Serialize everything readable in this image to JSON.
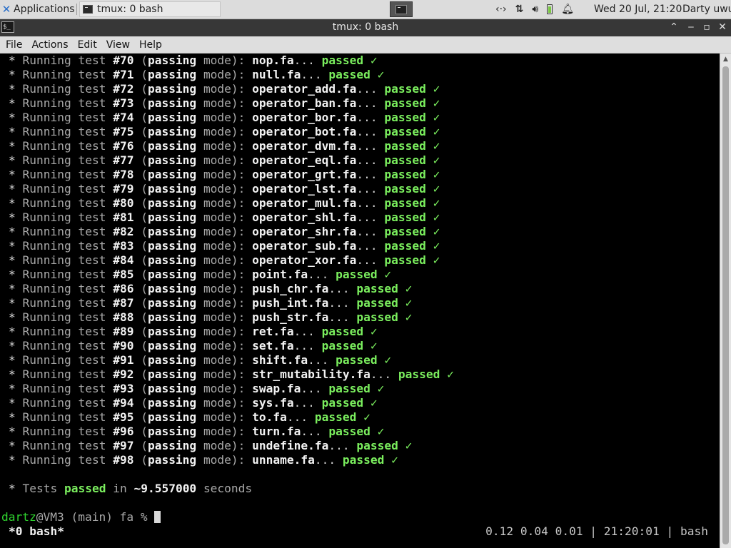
{
  "panel": {
    "apps_label": "Applications",
    "task_label": "tmux: 0 bash",
    "clock": "Wed 20 Jul, 21:20",
    "user": "Darty uwu",
    "icons": [
      "xfce-icon",
      "terminal-icon",
      "network-icon",
      "transfer-icon",
      "volume-icon",
      "battery-icon",
      "notification-bell-icon"
    ]
  },
  "window": {
    "title": "tmux: 0 bash",
    "icon_text": "$_"
  },
  "menubar": {
    "file": "File",
    "actions": "Actions",
    "edit": "Edit",
    "view": "View",
    "help": "Help"
  },
  "tests": [
    {
      "num": "#70",
      "file": "nop.fa"
    },
    {
      "num": "#71",
      "file": "null.fa"
    },
    {
      "num": "#72",
      "file": "operator_add.fa"
    },
    {
      "num": "#73",
      "file": "operator_ban.fa"
    },
    {
      "num": "#74",
      "file": "operator_bor.fa"
    },
    {
      "num": "#75",
      "file": "operator_bot.fa"
    },
    {
      "num": "#76",
      "file": "operator_dvm.fa"
    },
    {
      "num": "#77",
      "file": "operator_eql.fa"
    },
    {
      "num": "#78",
      "file": "operator_grt.fa"
    },
    {
      "num": "#79",
      "file": "operator_lst.fa"
    },
    {
      "num": "#80",
      "file": "operator_mul.fa"
    },
    {
      "num": "#81",
      "file": "operator_shl.fa"
    },
    {
      "num": "#82",
      "file": "operator_shr.fa"
    },
    {
      "num": "#83",
      "file": "operator_sub.fa"
    },
    {
      "num": "#84",
      "file": "operator_xor.fa"
    },
    {
      "num": "#85",
      "file": "point.fa"
    },
    {
      "num": "#86",
      "file": "push_chr.fa"
    },
    {
      "num": "#87",
      "file": "push_int.fa"
    },
    {
      "num": "#88",
      "file": "push_str.fa"
    },
    {
      "num": "#89",
      "file": "ret.fa"
    },
    {
      "num": "#90",
      "file": "set.fa"
    },
    {
      "num": "#91",
      "file": "shift.fa"
    },
    {
      "num": "#92",
      "file": "str_mutability.fa"
    },
    {
      "num": "#93",
      "file": "swap.fa"
    },
    {
      "num": "#94",
      "file": "sys.fa"
    },
    {
      "num": "#95",
      "file": "to.fa"
    },
    {
      "num": "#96",
      "file": "turn.fa"
    },
    {
      "num": "#97",
      "file": "undefine.fa"
    },
    {
      "num": "#98",
      "file": "unname.fa"
    }
  ],
  "test_line": {
    "bullet": "*",
    "running": "Running test",
    "mode_open": "(",
    "mode": "passing",
    "mode_close": "mode):",
    "dots": "...",
    "status": "passed",
    "check": "✓"
  },
  "summary": {
    "bullet": "*",
    "tests": "Tests",
    "passed": "passed",
    "in": "in",
    "time": "~9.557000",
    "seconds": "seconds"
  },
  "prompt": {
    "user": "dartz",
    "host": "@VM3 (main) fa %"
  },
  "statusbar": {
    "window": "*0 bash*",
    "right": "0.12 0.04 0.01 | 21:20:01 | bash"
  }
}
